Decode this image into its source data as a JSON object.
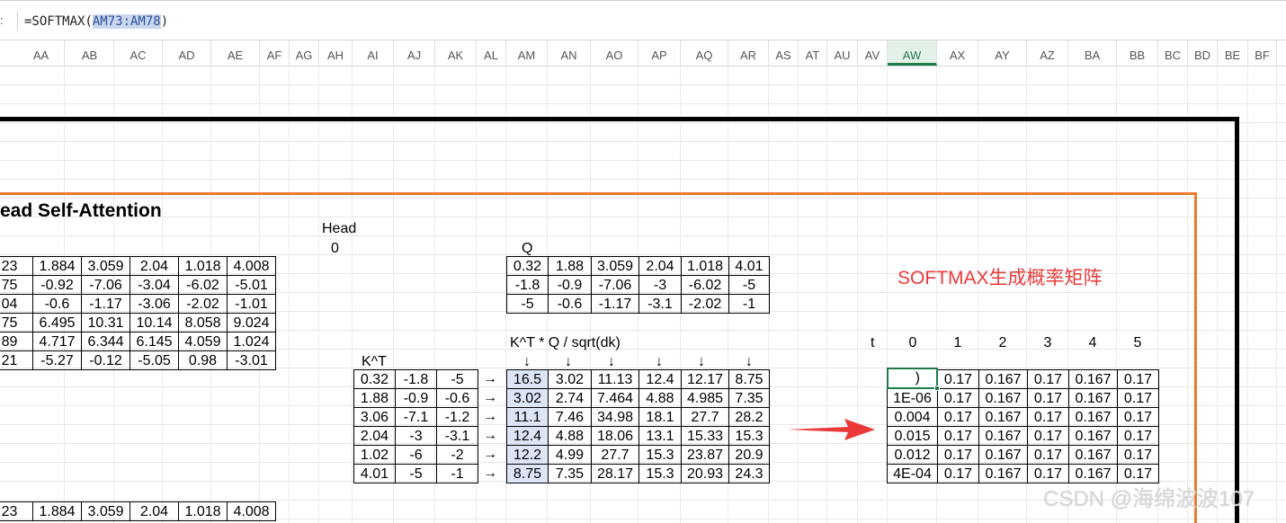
{
  "formula_bar": {
    "name_box_fragment": ":",
    "prefix": "=SOFTMAX(",
    "range": "AM73:AM78",
    "suffix": ")"
  },
  "columns": [
    "AA",
    "AB",
    "AC",
    "AD",
    "AE",
    "AF",
    "AG",
    "AH",
    "AI",
    "AJ",
    "AK",
    "AL",
    "AM",
    "AN",
    "AO",
    "AP",
    "AQ",
    "AR",
    "AS",
    "AT",
    "AU",
    "AV",
    "AW",
    "AX",
    "AY",
    "AZ",
    "BA",
    "BB",
    "BC",
    "BD",
    "BE",
    "BF"
  ],
  "selected_column": "AW",
  "labels": {
    "title": "ead Self-Attention",
    "head": "Head",
    "head_index": "0",
    "q": "Q",
    "kt": "K^T",
    "formula": "K^T * Q / sqrt(dk)",
    "softmax": "SOFTMAX生成概率矩阵",
    "t": "t",
    "arrow": "→",
    "down_arrow": "↓"
  },
  "left_table": [
    [
      "23",
      "1.884",
      "3.059",
      "2.04",
      "1.018",
      "4.008"
    ],
    [
      "75",
      "-0.92",
      "-7.06",
      "-3.04",
      "-6.02",
      "-5.01"
    ],
    [
      "04",
      "-0.6",
      "-1.17",
      "-3.06",
      "-2.02",
      "-1.01"
    ],
    [
      "75",
      "6.495",
      "10.31",
      "10.14",
      "8.058",
      "9.024"
    ],
    [
      "89",
      "4.717",
      "6.344",
      "6.145",
      "4.059",
      "1.024"
    ],
    [
      "21",
      "-5.27",
      "-0.12",
      "-5.05",
      "0.98",
      "-3.01"
    ]
  ],
  "bottom_row": [
    "23",
    "1.884",
    "3.059",
    "2.04",
    "1.018",
    "4.008"
  ],
  "q_matrix": [
    [
      "0.32",
      "1.88",
      "3.059",
      "2.04",
      "1.018",
      "4.01"
    ],
    [
      "-1.8",
      "-0.9",
      "-7.06",
      "-3",
      "-6.02",
      "-5"
    ],
    [
      "-5",
      "-0.6",
      "-1.17",
      "-3.1",
      "-2.02",
      "-1"
    ]
  ],
  "kt_matrix": [
    [
      "0.32",
      "-1.8",
      "-5"
    ],
    [
      "1.88",
      "-0.9",
      "-0.6"
    ],
    [
      "3.06",
      "-7.1",
      "-1.2"
    ],
    [
      "2.04",
      "-3",
      "-3.1"
    ],
    [
      "1.02",
      "-6",
      "-2"
    ],
    [
      "4.01",
      "-5",
      "-1"
    ]
  ],
  "scores": [
    [
      "16.5",
      "3.02",
      "11.13",
      "12.4",
      "12.17",
      "8.75"
    ],
    [
      "3.02",
      "2.74",
      "7.464",
      "4.88",
      "4.985",
      "7.35"
    ],
    [
      "11.1",
      "7.46",
      "34.98",
      "18.1",
      "27.7",
      "28.2"
    ],
    [
      "12.4",
      "4.88",
      "18.06",
      "13.1",
      "15.33",
      "15.3"
    ],
    [
      "12.2",
      "4.99",
      "27.7",
      "15.3",
      "23.87",
      "20.9"
    ],
    [
      "8.75",
      "7.35",
      "28.17",
      "15.3",
      "20.93",
      "24.3"
    ]
  ],
  "softmax_indices": [
    "0",
    "1",
    "2",
    "3",
    "4",
    "5"
  ],
  "softmax": [
    [
      "",
      "0.17",
      "0.167",
      "0.17",
      "0.167",
      "0.17"
    ],
    [
      "1E-06",
      "0.17",
      "0.167",
      "0.17",
      "0.167",
      "0.17"
    ],
    [
      "0.004",
      "0.17",
      "0.167",
      "0.17",
      "0.167",
      "0.17"
    ],
    [
      "0.015",
      "0.17",
      "0.167",
      "0.17",
      "0.167",
      "0.17"
    ],
    [
      "0.012",
      "0.17",
      "0.167",
      "0.17",
      "0.167",
      "0.17"
    ],
    [
      "4E-04",
      "0.17",
      "0.167",
      "0.17",
      "0.167",
      "0.17"
    ]
  ],
  "active_cell_text": ")",
  "watermark": "CSDN @海绵波波107",
  "colors": {
    "accent": "#1f7a4a",
    "frame_orange": "#ec7a2e",
    "softmax_label": "#ec3a3a",
    "selection": "#dbe5f5"
  }
}
